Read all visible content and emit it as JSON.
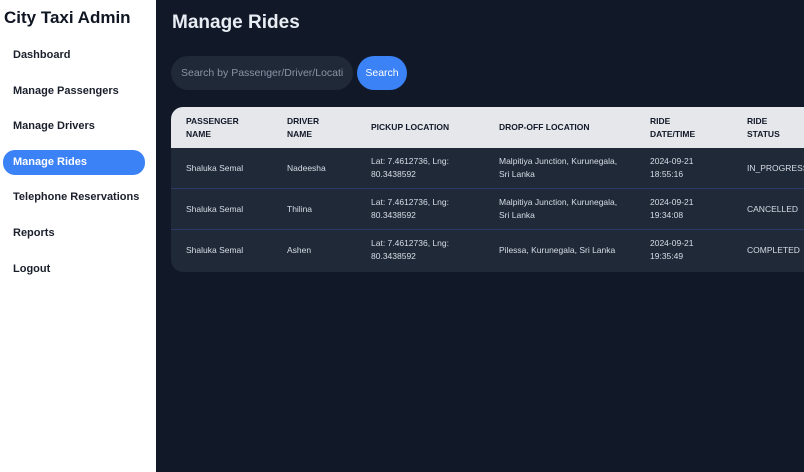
{
  "sidebar": {
    "brand": "City Taxi Admin",
    "items": [
      {
        "label": "Dashboard"
      },
      {
        "label": "Manage Passengers"
      },
      {
        "label": "Manage Drivers"
      },
      {
        "label": "Manage Rides",
        "active": true
      },
      {
        "label": "Telephone Reservations"
      },
      {
        "label": "Reports"
      },
      {
        "label": "Logout"
      }
    ]
  },
  "main": {
    "title": "Manage Rides",
    "search": {
      "placeholder": "Search by Passenger/Driver/Location",
      "value": "",
      "button_label": "Search"
    },
    "table": {
      "headers": [
        [
          "PASSENGER",
          "NAME"
        ],
        [
          "DRIVER",
          "NAME"
        ],
        [
          "PICKUP LOCATION",
          ""
        ],
        [
          "DROP-OFF LOCATION",
          ""
        ],
        [
          "RIDE",
          "DATE/TIME"
        ],
        [
          "RIDE",
          "STATUS"
        ]
      ],
      "rows": [
        {
          "passenger": "Shaluka Semal",
          "driver": "Nadeesha",
          "pickup": [
            "Lat: 7.4612736, Lng:",
            "80.3438592"
          ],
          "dropoff": [
            "Malpitiya Junction, Kurunegala,",
            "Sri Lanka"
          ],
          "datetime": [
            "2024-09-21",
            "18:55:16"
          ],
          "status": "IN_PROGRESS"
        },
        {
          "passenger": "Shaluka Semal",
          "driver": "Thilina",
          "pickup": [
            "Lat: 7.4612736, Lng:",
            "80.3438592"
          ],
          "dropoff": [
            "Malpitiya Junction, Kurunegala,",
            "Sri Lanka"
          ],
          "datetime": [
            "2024-09-21",
            "19:34:08"
          ],
          "status": "CANCELLED"
        },
        {
          "passenger": "Shaluka Semal",
          "driver": "Ashen",
          "pickup": [
            "Lat: 7.4612736, Lng:",
            "80.3438592"
          ],
          "dropoff": [
            "Pilessa, Kurunegala, Sri Lanka",
            ""
          ],
          "datetime": [
            "2024-09-21",
            "19:35:49"
          ],
          "status": "COMPLETED"
        }
      ]
    }
  },
  "colors": {
    "sidebar_bg": "#ffffff",
    "main_bg": "#111827",
    "accent": "#3b82f6",
    "table_bg": "#1f2937",
    "table_header_bg": "#e5e7eb"
  }
}
